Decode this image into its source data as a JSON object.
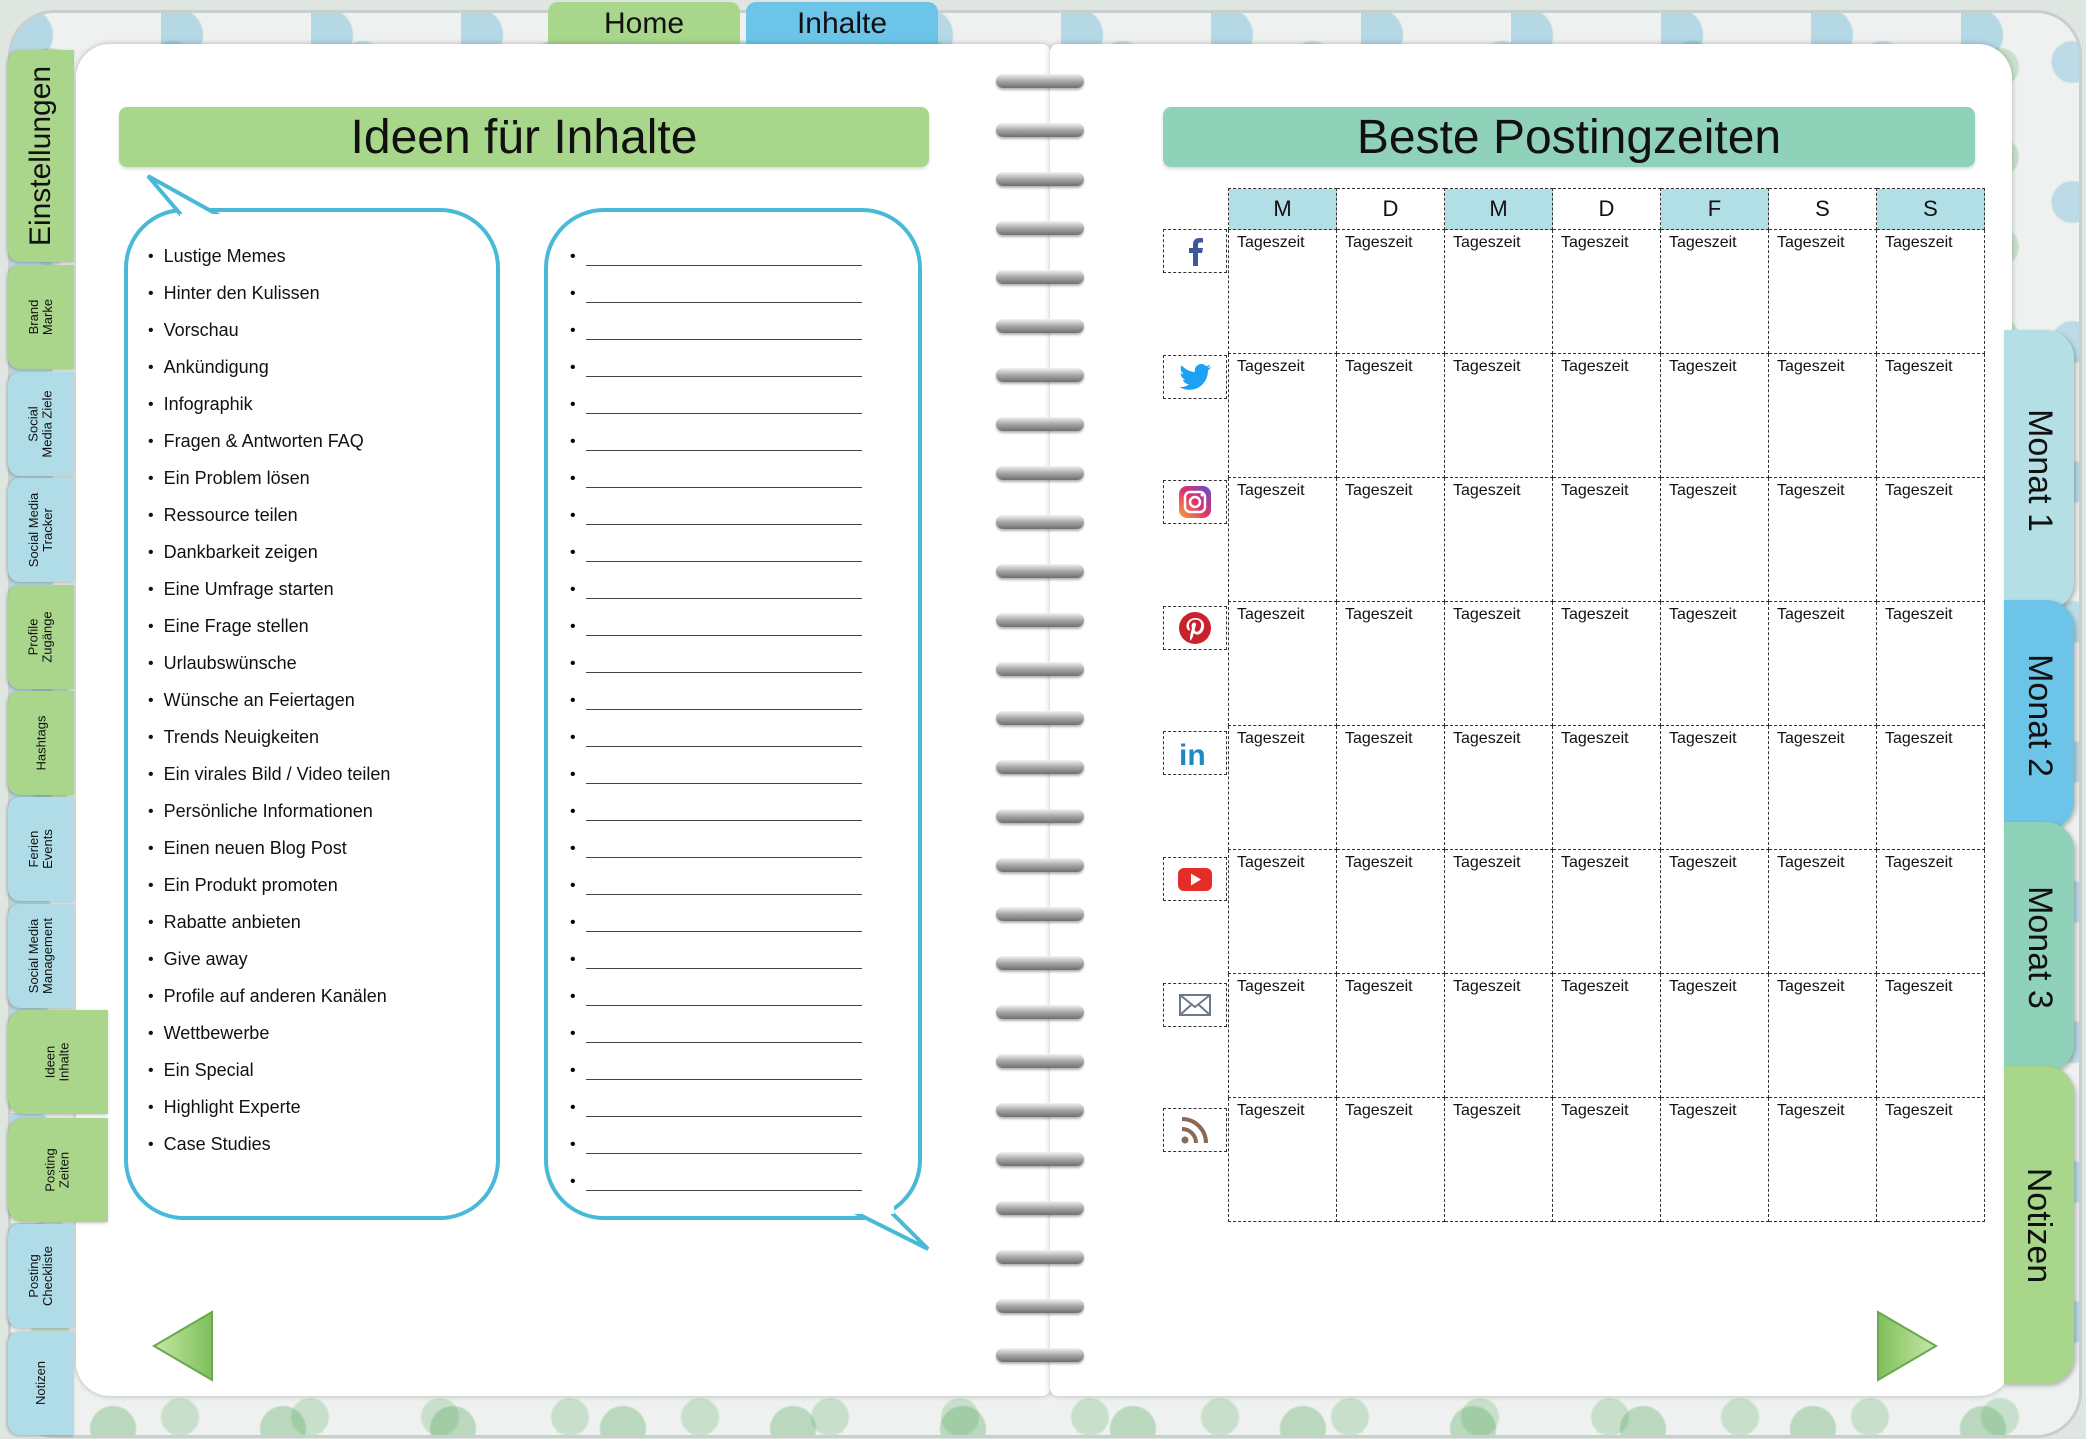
{
  "top_tabs": {
    "home": "Home",
    "inhalte": "Inhalte"
  },
  "left_tabs": [
    {
      "label": "Einstellungen",
      "style": "green"
    },
    {
      "label": "Brand\nMarke",
      "style": "green"
    },
    {
      "label": "Social\nMedia Ziele",
      "style": "blue"
    },
    {
      "label": "Social Media\nTracker",
      "style": "blue"
    },
    {
      "label": "Profile\nZugänge",
      "style": "green"
    },
    {
      "label": "Hashtags",
      "style": "green"
    },
    {
      "label": "Ferien\nEvents",
      "style": "blue"
    },
    {
      "label": "Social Media\nManagement",
      "style": "blue"
    },
    {
      "label": "Ideen\nInhalte",
      "style": "green"
    },
    {
      "label": "Posting\nZeiten",
      "style": "green"
    },
    {
      "label": "Posting\nCheckliste",
      "style": "blue"
    },
    {
      "label": "Notizen",
      "style": "blue"
    }
  ],
  "right_tabs": [
    "Monat 1",
    "Monat 2",
    "Monat 3",
    "Notizen"
  ],
  "ideas": {
    "title": "Ideen für Inhalte",
    "items": [
      "Lustige Memes",
      "Hinter den Kulissen",
      "Vorschau",
      "Ankündigung",
      "Infographik",
      "Fragen & Antworten FAQ",
      "Ein Problem lösen",
      "Ressource teilen",
      "Dankbarkeit zeigen",
      "Eine Umfrage starten",
      "Eine Frage stellen",
      "Urlaubswünsche",
      "Wünsche an Feiertagen",
      "Trends Neuigkeiten",
      "Ein virales Bild / Video teilen",
      "Persönliche Informationen",
      "Einen neuen Blog Post",
      "Ein Produkt promoten",
      "Rabatte anbieten",
      "Give away",
      "Profile auf anderen Kanälen",
      "Wettbewerbe",
      "Ein Special",
      "Highlight Experte",
      "Case Studies"
    ],
    "blank_line_count": 26
  },
  "posting_times": {
    "title": "Beste Postingzeiten",
    "days": [
      "M",
      "D",
      "M",
      "D",
      "F",
      "S",
      "S"
    ],
    "cell_text": "Tageszeit",
    "platforms": [
      {
        "icon": "facebook-icon"
      },
      {
        "icon": "twitter-icon"
      },
      {
        "icon": "instagram-icon"
      },
      {
        "icon": "pinterest-icon"
      },
      {
        "icon": "linkedin-icon"
      },
      {
        "icon": "youtube-icon"
      },
      {
        "icon": "email-icon"
      },
      {
        "icon": "rss-icon"
      }
    ]
  },
  "colors": {
    "green": "#a8d68a",
    "blue": "#6cc5e8",
    "teal": "#90d2b9",
    "bubble_border": "#49b9d8"
  }
}
